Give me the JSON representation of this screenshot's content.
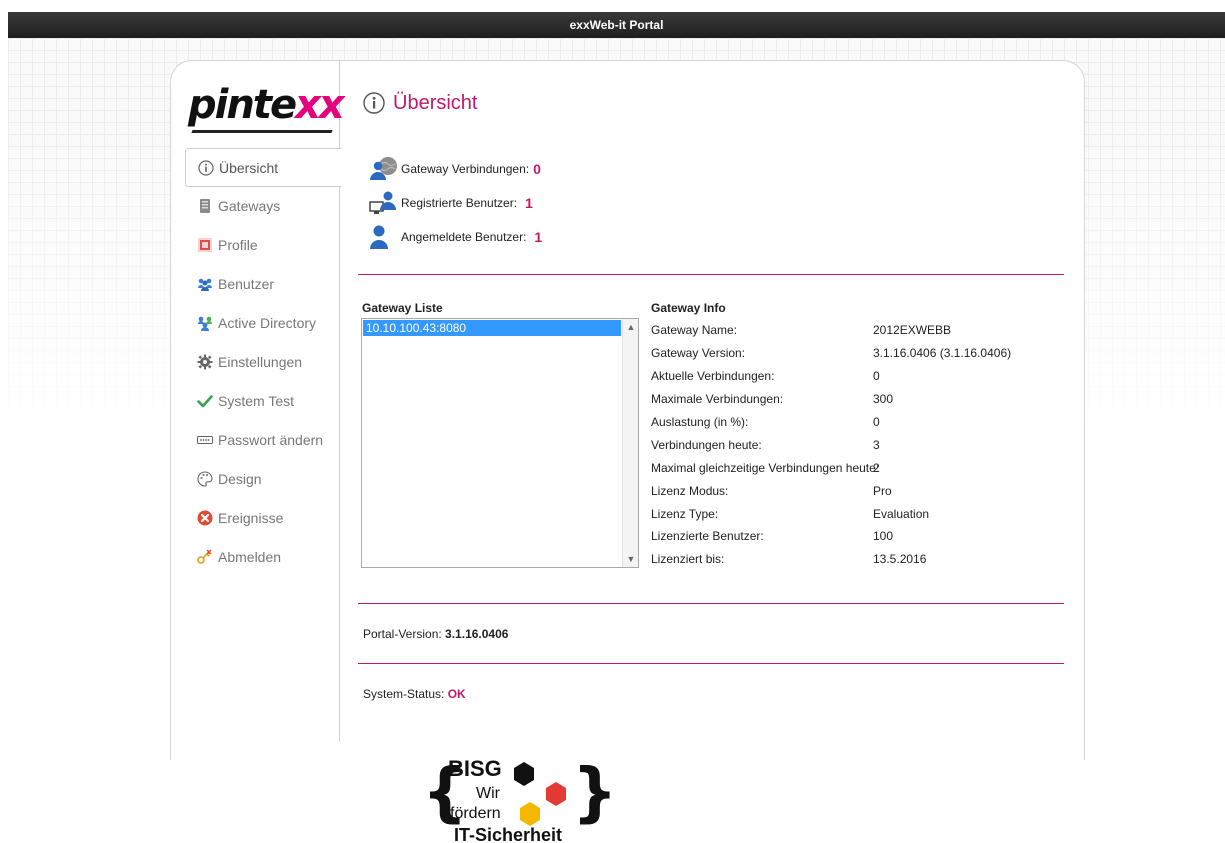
{
  "header": {
    "title": "exxWeb-it Portal"
  },
  "logo": {
    "text_a": "pinte",
    "text_b": "xx"
  },
  "sidebar": {
    "items": [
      {
        "label": "Übersicht",
        "icon": "info-icon",
        "active": true
      },
      {
        "label": "Gateways",
        "icon": "gateway-icon"
      },
      {
        "label": "Profile",
        "icon": "profile-icon"
      },
      {
        "label": "Benutzer",
        "icon": "users-icon"
      },
      {
        "label": "Active Directory",
        "icon": "active-directory-icon"
      },
      {
        "label": "Einstellungen",
        "icon": "gear-icon"
      },
      {
        "label": "System Test",
        "icon": "checkmark-icon"
      },
      {
        "label": "Passwort ändern",
        "icon": "password-icon"
      },
      {
        "label": "Design",
        "icon": "palette-icon"
      },
      {
        "label": "Ereignisse",
        "icon": "error-icon"
      },
      {
        "label": "Abmelden",
        "icon": "logout-icon"
      }
    ]
  },
  "main": {
    "title": "Übersicht",
    "stats": [
      {
        "label": "Gateway Verbindungen:",
        "value": "0",
        "icon": "globe-user-icon"
      },
      {
        "label": "Registrierte Benutzer:",
        "value": "1",
        "icon": "computer-user-icon"
      },
      {
        "label": "Angemeldete Benutzer:",
        "value": "1",
        "icon": "user-icon"
      }
    ],
    "gateway_list": {
      "title": "Gateway Liste",
      "items": [
        "10.10.100.43:8080"
      ],
      "selected": "10.10.100.43:8080"
    },
    "gateway_info": {
      "title": "Gateway Info",
      "rows": [
        {
          "key": "Gateway Name:",
          "value": "2012EXWEBB"
        },
        {
          "key": "Gateway Version:",
          "value": "3.1.16.0406 (3.1.16.0406)"
        },
        {
          "key": "Aktuelle Verbindungen:",
          "value": "0"
        },
        {
          "key": "Maximale Verbindungen:",
          "value": "300"
        },
        {
          "key": "Auslastung (in %):",
          "value": "0"
        },
        {
          "key": "Verbindungen heute:",
          "value": "3"
        },
        {
          "key": "Maximal gleichzeitige Verbindungen heute:",
          "value": "2"
        },
        {
          "key": "Lizenz Modus:",
          "value": "Pro"
        },
        {
          "key": "Lizenz Type:",
          "value": "Evaluation"
        },
        {
          "key": "Lizenzierte Benutzer:",
          "value": "100"
        },
        {
          "key": "Lizenziert bis:",
          "value": "13.5.2016"
        }
      ]
    },
    "portal_version": {
      "label": "Portal-Version:",
      "value": "3.1.16.0406"
    },
    "system_status": {
      "label": "System-Status:",
      "value": "OK"
    }
  },
  "badge": {
    "line1": "BISG",
    "line2": "Wir",
    "line3": "fördern",
    "line4": "IT-Sicherheit"
  },
  "colors": {
    "accent": "#c0186a",
    "selection": "#3399ff",
    "header_bg": "#2a2a2a"
  }
}
